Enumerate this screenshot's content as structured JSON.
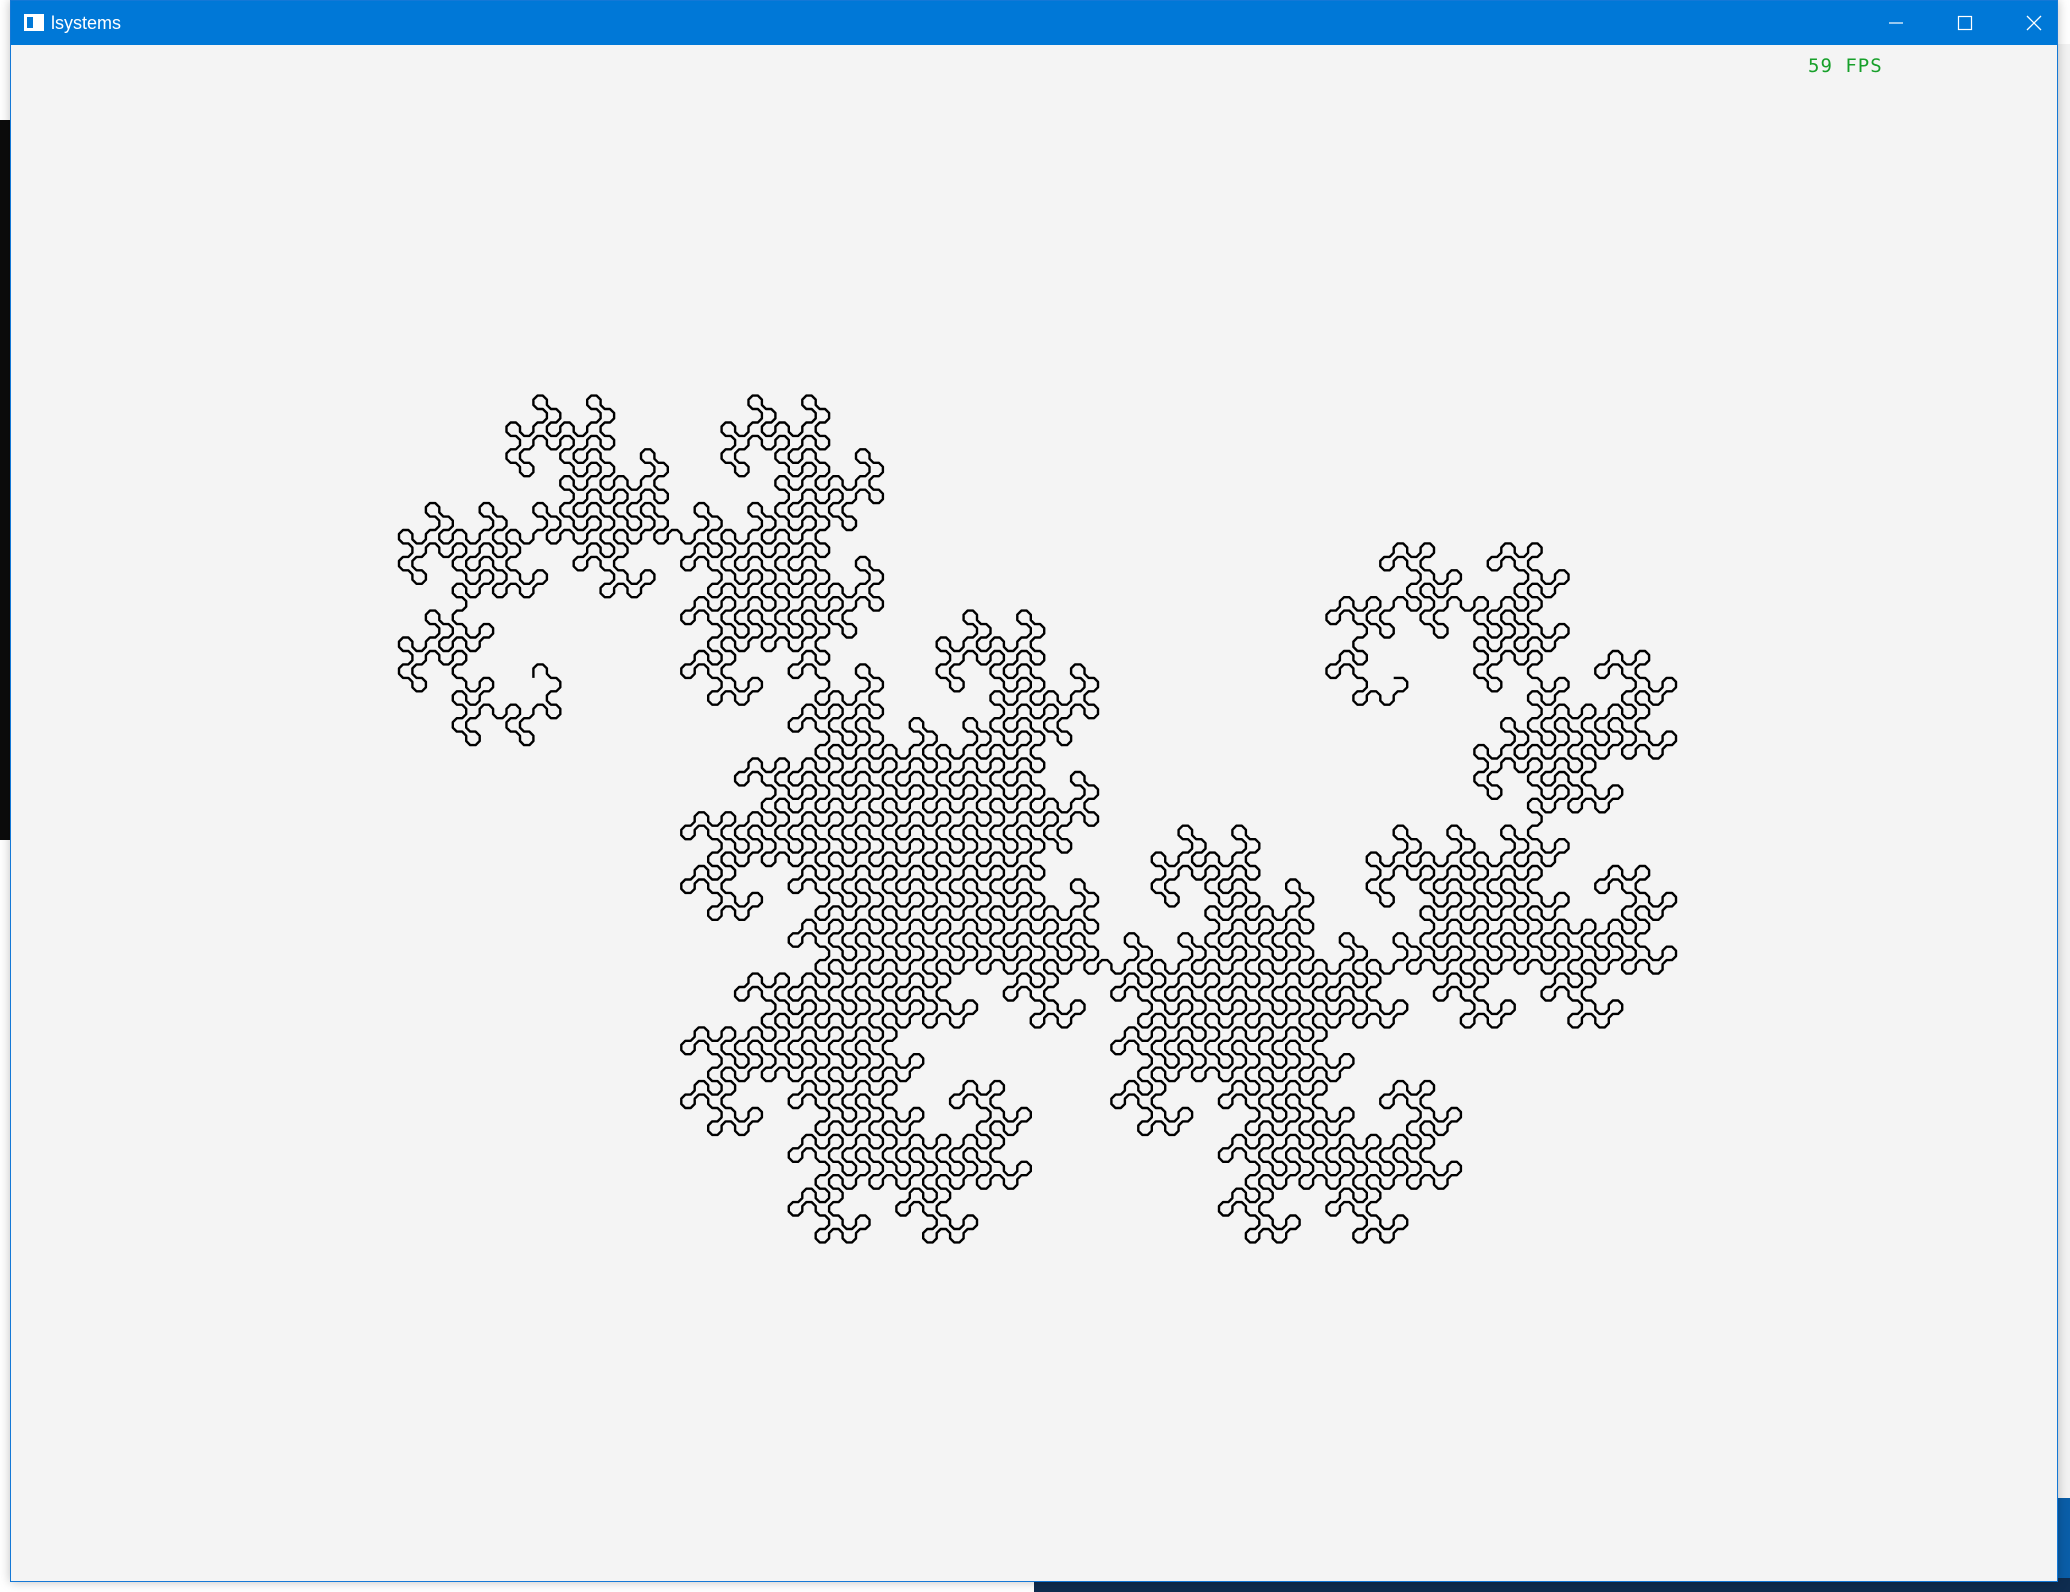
{
  "window": {
    "title": "lsystems",
    "icon": "app-window-icon",
    "accent": "#0078d7",
    "controls": {
      "minimize_icon": "minimize-icon",
      "maximize_icon": "maximize-icon",
      "close_icon": "close-icon"
    }
  },
  "canvas": {
    "fps_text": "59 FPS",
    "fps_color": "#17a02a",
    "background": "#f4f4f4",
    "stroke_color": "#000000",
    "figure": "dragon-curve"
  }
}
